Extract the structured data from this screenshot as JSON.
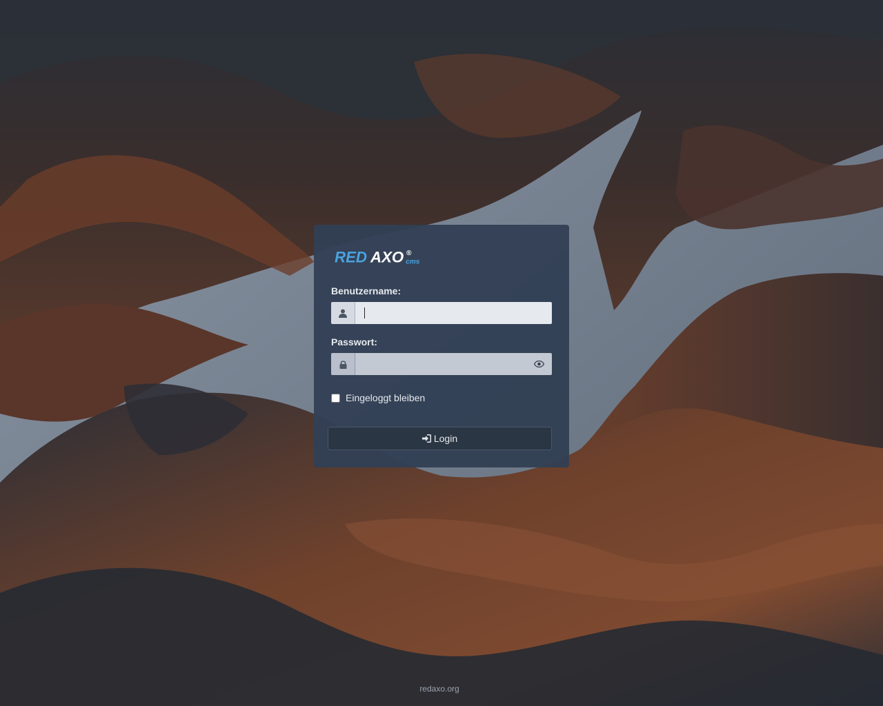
{
  "brand": {
    "logo_part1": "RED",
    "logo_part2": "AXO",
    "logo_registered": "®",
    "logo_suffix": "cms",
    "color_blue": "#4aa3df",
    "color_white": "#ffffff"
  },
  "form": {
    "username_label": "Benutzername:",
    "username_value": "",
    "password_label": "Passwort:",
    "password_value": "",
    "remember_label": "Eingeloggt bleiben",
    "remember_checked": false,
    "login_label": "Login"
  },
  "icons": {
    "username": "user-icon",
    "password": "lock-icon",
    "toggle_password": "eye-icon",
    "login": "sign-in-icon"
  },
  "footer": {
    "link_text": "redaxo.org"
  }
}
